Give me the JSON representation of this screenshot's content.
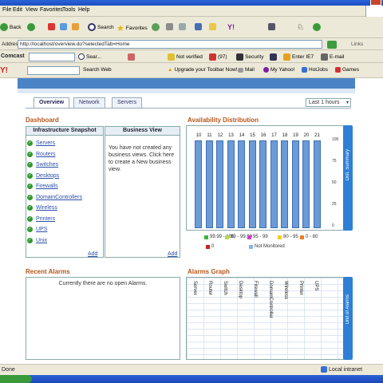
{
  "browser": {
    "menu": [
      "File",
      "Edit",
      "View",
      "Favorites",
      "Tools",
      "Help"
    ],
    "nav": {
      "back": "Back",
      "search": "Search",
      "favorites": "Favorites"
    },
    "address_label": "Address",
    "address": "http://localhost/overview.do?selectedTab=Home",
    "links_label": "Links",
    "toolbar2": {
      "brand": "Comcast",
      "search_btn": "Sear...",
      "not_verified": "Not verified",
      "count": "(97)",
      "security": "Security",
      "enter_ie": "Enter IE7",
      "email": "E-mail"
    },
    "toolbar3": {
      "search_web": "Search Web",
      "upgrade": "Upgrade your Toolbar Now!",
      "mail": "Mail",
      "my_yahoo": "My Yahoo!",
      "hotjobs": "HotJobs",
      "games": "Games"
    }
  },
  "tabs": [
    "Overview",
    "Network",
    "Servers"
  ],
  "time_select": "Last 1 hours",
  "dashboard": {
    "title": "Dashboard",
    "infra_title": "Infrastructure Snapshot",
    "infra_items": [
      "Servers",
      "Routers",
      "Switches",
      "Desktops",
      "Firewalls",
      "DomainControllers",
      "Wireless",
      "Printers",
      "UPS",
      "Unix"
    ],
    "infra_add": "Add",
    "bview_title": "Business View",
    "bview_text": "You have not created any business views. Click here to create a New business view.",
    "bview_add": "Add"
  },
  "availability": {
    "title": "Availability Distribution",
    "hours": [
      "10",
      "11",
      "12",
      "13",
      "14",
      "15",
      "16",
      "17",
      "18",
      "19",
      "20",
      "21"
    ],
    "yticks": [
      "100",
      "75",
      "50",
      "25",
      "0"
    ],
    "side_tab": "Dist. Summary",
    "legend": [
      {
        "label": "99.99 - 100",
        "color": "#3db33d"
      },
      {
        "label": "99 - 99.99",
        "color": "#b9d84a"
      },
      {
        "label": "95 - 99",
        "color": "#d040c8"
      },
      {
        "label": "80 - 95",
        "color": "#f0d020"
      },
      {
        "label": "0 - 80",
        "color": "#f08020"
      },
      {
        "label": "0",
        "color": "#d02020"
      },
      {
        "label": "Not Monitored",
        "color": "#8ab4e8"
      }
    ]
  },
  "recent_alarms": {
    "title": "Recent Alarms",
    "message": "Currently there are no open Alarms."
  },
  "alarms_graph": {
    "title": "Alarms Graph",
    "columns": [
      "Server",
      "Router",
      "Switch",
      "Desktop",
      "Firewall",
      "DomainController",
      "Wireless",
      "Printer",
      "UPS"
    ],
    "side_tab": "Unit of Alarms"
  },
  "status": {
    "left": "Done",
    "zone": "Local intranet"
  }
}
